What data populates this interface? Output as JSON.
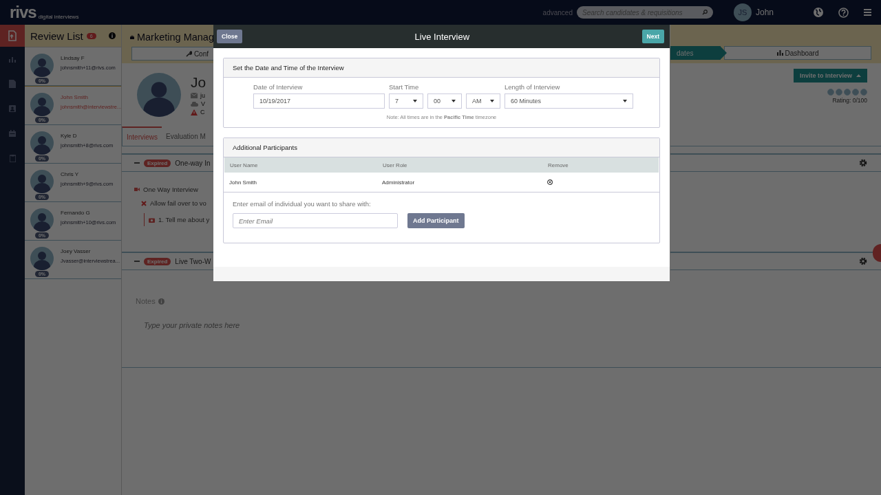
{
  "top_bar": {
    "logo": "rivs",
    "logo_tagline": "digital interviews",
    "advanced_link": "advanced",
    "search": {
      "placeholder": "Search candidates & requisitions"
    },
    "user": {
      "initials": "JS",
      "name": "John"
    }
  },
  "nav_rail": [
    {
      "kind": "upload",
      "selected": true
    },
    {
      "kind": "chart",
      "selected": false
    },
    {
      "kind": "document",
      "selected": false
    },
    {
      "kind": "contact",
      "selected": false
    },
    {
      "kind": "calendar",
      "selected": false
    },
    {
      "kind": "clipboard",
      "selected": false
    }
  ],
  "review_list": {
    "title": "Review List",
    "count": "6",
    "candidates": [
      {
        "name": "Lindsay F",
        "email": "johnsmith+11@rivs.com",
        "score": "0%",
        "selected": false
      },
      {
        "name": "John Smith",
        "email": "johnsmith@interviewstre...",
        "score": "0%",
        "selected": true
      },
      {
        "name": "Kyle D",
        "email": "johnsmith+8@rivs.com",
        "score": "0%",
        "selected": false
      },
      {
        "name": "Chris Y",
        "email": "johnsmith+9@rivs.com",
        "score": "0%",
        "selected": false
      },
      {
        "name": "Fernando G",
        "email": "johnsmith+10@rivs.com",
        "score": "0%",
        "selected": false
      },
      {
        "name": "Joey Vasser",
        "email": "Jvasser@interviewstrea...",
        "score": "0%",
        "selected": false
      }
    ]
  },
  "job": {
    "title": "Marketing Manag",
    "steps": [
      {
        "label": "Conf",
        "selected": false
      },
      {
        "label": "dates",
        "selected": true
      },
      {
        "label": "Dashboard",
        "selected": false
      }
    ]
  },
  "candidate": {
    "name": "Jo",
    "details": [
      {
        "kind": "email",
        "text": "ju"
      },
      {
        "kind": "cloud",
        "text": "V"
      },
      {
        "kind": "warning",
        "text": "C"
      }
    ],
    "invite_button": "Invite to Interview",
    "rating": "Rating: 0/100"
  },
  "tabs": [
    {
      "label": "Interviews",
      "selected": true
    },
    {
      "label": "Evaluation M",
      "selected": false
    }
  ],
  "interviews": [
    {
      "status": "Expired",
      "title": "One-way In",
      "type": "One Way Interview",
      "fail_over": "Allow fail over to vo",
      "questions": [
        "1. Tell me about y"
      ]
    },
    {
      "status": "Expired",
      "title": "Live Two-W"
    }
  ],
  "notes": {
    "title": "Notes",
    "placeholder": "Type your private notes here"
  },
  "modal": {
    "title": "Live Interview",
    "close_button": "Close",
    "next_button": "Next",
    "schedule": {
      "title": "Set the Date and Time of the Interview",
      "date_label": "Date of Interview",
      "date": "10/19/2017",
      "start_label": "Start Time",
      "hour": "7",
      "minute": "00",
      "period": "AM",
      "length_label": "Length of Interview",
      "length": "60 Minutes",
      "note": "Note: All times are in the **Pacific Time** timezone"
    },
    "participants": {
      "title": "Additional Participants",
      "columns": [
        "User Name",
        "User Role",
        "Remove"
      ],
      "rows": [
        {
          "name": "John Smith",
          "role": "Administrator"
        }
      ],
      "share_label": "Enter email of individual you want to share with:",
      "email_placeholder": "Enter Email",
      "add_button": "Add Participant"
    }
  }
}
